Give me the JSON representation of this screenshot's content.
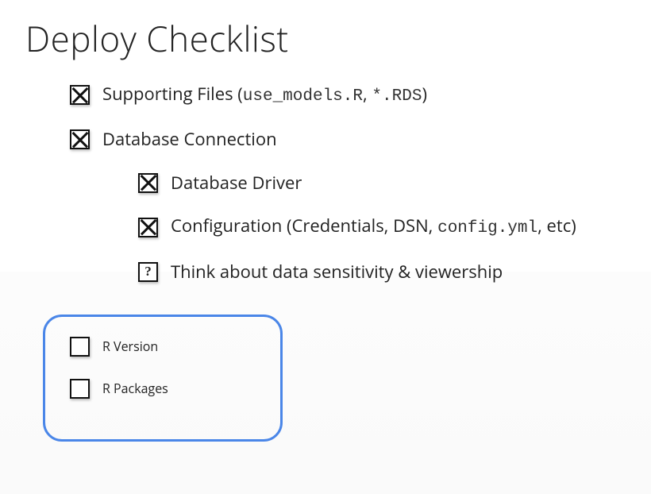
{
  "title": "Deploy Checklist",
  "items": [
    {
      "state": "checked",
      "text_pre": "Supporting Files (",
      "code1": "use_models.R",
      "mid": ", ",
      "code2": "*.RDS",
      "text_post": ")"
    },
    {
      "state": "checked",
      "text": "Database Connection",
      "children": [
        {
          "state": "checked",
          "text": "Database Driver"
        },
        {
          "state": "checked",
          "text_pre": "Configuration (Credentials, DSN, ",
          "code1": "config.yml",
          "text_post": ", etc)"
        },
        {
          "state": "question",
          "text": "Think about data sensitivity & viewership"
        }
      ]
    }
  ],
  "highlighted": [
    {
      "state": "unchecked",
      "text": "R Version"
    },
    {
      "state": "unchecked",
      "text": "R Packages"
    }
  ],
  "glyphs": {
    "question": "?"
  },
  "colors": {
    "highlight": "#4a86e8"
  }
}
